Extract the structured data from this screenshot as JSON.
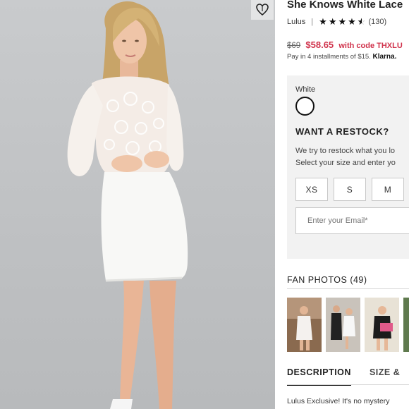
{
  "product": {
    "title": "She Knows White Lace",
    "brand": "Lulus",
    "rating_stars": 4.5,
    "review_count": "(130)",
    "original_price": "$69",
    "sale_price": "$58.65",
    "promo_text": "with code THXLU",
    "installments_text": "Pay in 4 installments of $15.",
    "installments_provider": "Klarna."
  },
  "options": {
    "color_label": "White",
    "swatch_color": "#ffffff"
  },
  "restock": {
    "title": "WANT A RESTOCK?",
    "line1": "We try to restock what you lo",
    "line2": "Select your size and enter yo",
    "sizes": [
      "XS",
      "S",
      "M"
    ],
    "email_placeholder": "Enter your Email*"
  },
  "fan_photos": {
    "title": "FAN PHOTOS (49)",
    "count": 4
  },
  "tabs": {
    "description": "DESCRIPTION",
    "size": "SIZE &"
  },
  "description": {
    "text": "Lulus Exclusive! It's no mystery"
  },
  "colors": {
    "price_red": "#d0324b",
    "panel_gray": "#f2f2f2"
  },
  "icons": {
    "wishlist": "heart-icon",
    "swatch": "color-swatch",
    "rating": "star-icon"
  }
}
